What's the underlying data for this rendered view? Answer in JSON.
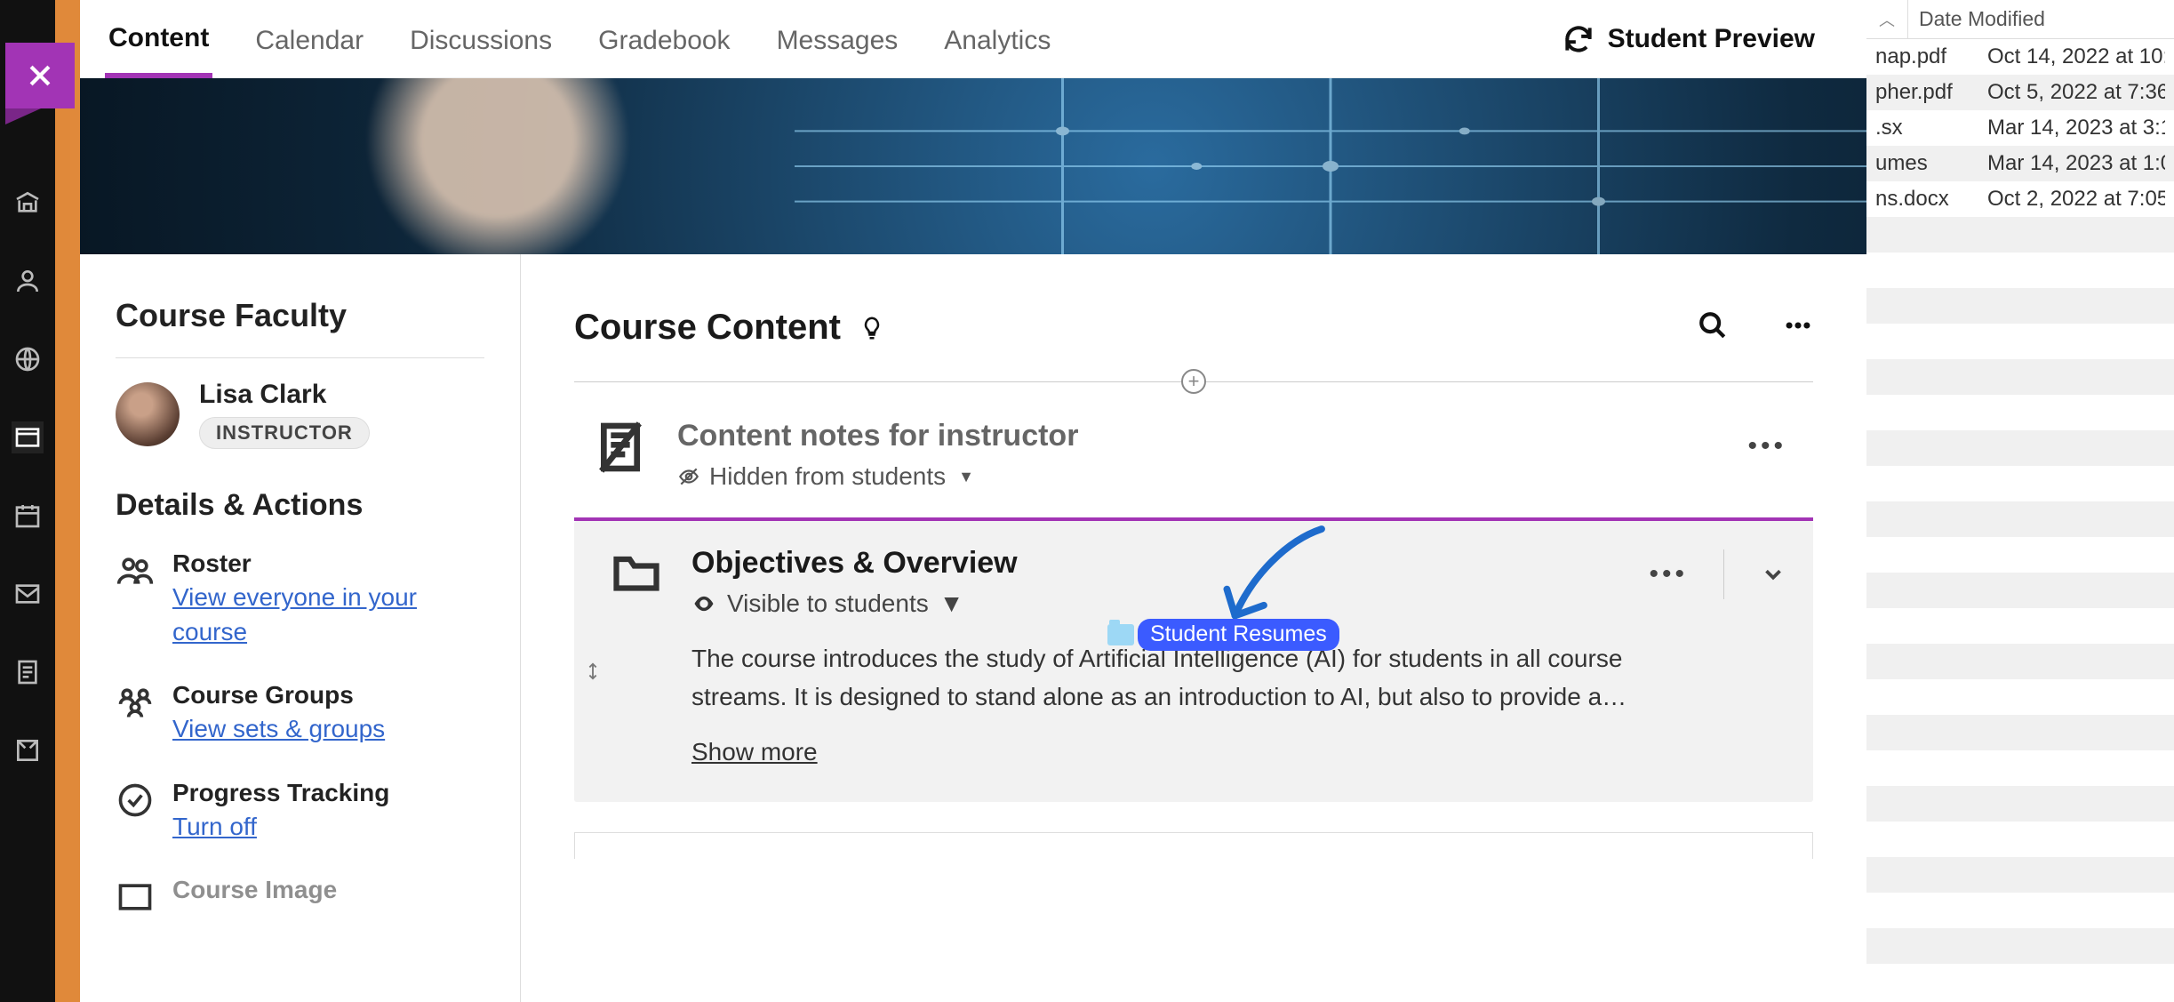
{
  "tabs": {
    "content": "Content",
    "calendar": "Calendar",
    "discussions": "Discussions",
    "gradebook": "Gradebook",
    "messages": "Messages",
    "analytics": "Analytics"
  },
  "student_preview": "Student Preview",
  "left": {
    "faculty_heading": "Course Faculty",
    "faculty_name": "Lisa Clark",
    "faculty_role": "INSTRUCTOR",
    "details_heading": "Details & Actions",
    "roster_title": "Roster",
    "roster_link": "View everyone in your course",
    "groups_title": "Course Groups",
    "groups_link": "View sets & groups",
    "progress_title": "Progress Tracking",
    "progress_link": "Turn off",
    "image_title": "Course Image"
  },
  "main": {
    "heading": "Course Content",
    "item1_title": "Content notes for instructor",
    "item1_visibility": "Hidden from students",
    "drag_label": "Student Resumes",
    "item2_title": "Objectives & Overview",
    "item2_visibility": "Visible to students",
    "item2_desc": "The course introduces the study of Artificial Intelligence (AI) for students in all course streams. It is designed to stand alone as an introduction to AI, but also to provide a…",
    "show_more": "Show more"
  },
  "files": {
    "col_header": "Date Modified",
    "rows": [
      {
        "name": "nap.pdf",
        "date": "Oct 14, 2022 at 10:"
      },
      {
        "name": "pher.pdf",
        "date": "Oct 5, 2022 at 7:36"
      },
      {
        "name": ".sx",
        "date": "Mar 14, 2023 at 3:1"
      },
      {
        "name": "umes",
        "date": "Mar 14, 2023 at 1:0"
      },
      {
        "name": "ns.docx",
        "date": "Oct 2, 2022 at 7:05"
      }
    ]
  }
}
